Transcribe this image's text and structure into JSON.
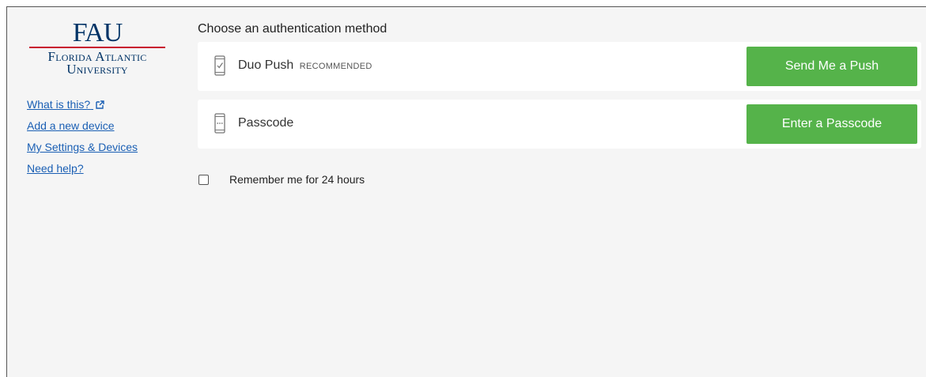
{
  "logo": {
    "mark": "FAU",
    "line1": "Florida Atlantic",
    "line2": "University"
  },
  "sidebar": {
    "links": [
      {
        "label": "What is this?",
        "icon": "external-link-icon"
      },
      {
        "label": "Add a new device"
      },
      {
        "label": "My Settings & Devices"
      },
      {
        "label": "Need help?"
      }
    ]
  },
  "main": {
    "heading": "Choose an authentication method",
    "methods": [
      {
        "label": "Duo Push",
        "badge": "RECOMMENDED",
        "icon": "phone-check-icon",
        "button": "Send Me a Push"
      },
      {
        "label": "Passcode",
        "badge": "",
        "icon": "phone-keypad-icon",
        "button": "Enter a Passcode"
      }
    ],
    "remember_label": "Remember me for 24 hours",
    "remember_checked": false
  },
  "colors": {
    "button_green": "#55b34a",
    "link_blue": "#1a5fb4",
    "brand_blue": "#003366",
    "brand_red": "#c8102e",
    "panel_bg": "#f5f5f5"
  }
}
